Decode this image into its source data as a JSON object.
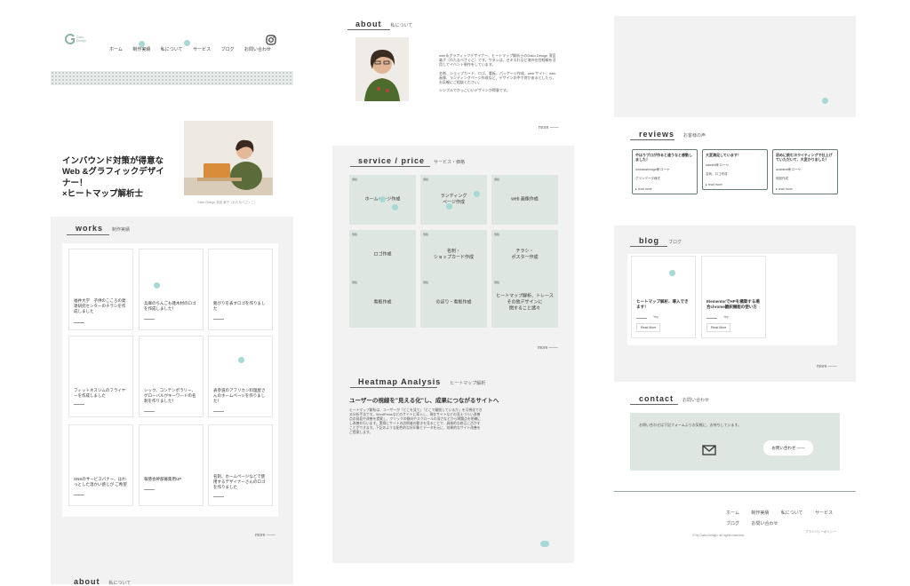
{
  "header": {
    "logo_text": "Gaku Design",
    "nav": [
      "ホーム",
      "制作実績",
      "私について",
      "サービス",
      "ブログ",
      "お問い合わせ"
    ],
    "instagram_icon": "instagram-icon"
  },
  "hero": {
    "headline": "インバウンド対策が得意な\nWeb &グラフィックデザイナー！\n×ヒートマップ解析士",
    "caption": "Gaku Design 英宮 楽子（わたなべさくこ）"
  },
  "works": {
    "title": "works",
    "subtitle": "制作実績",
    "items": [
      "福井大学　子供のこころの発達研究センターのチラシを作成しました",
      "兵庫のちんごも雑木材のロゴを作成しました！",
      "魁がりを表すロゴを作りました",
      "フィットネスジムのフライヤーを作成しました",
      "シック、コンテンポラリー、グローバルがキーワードの名刺を作りました！",
      "表参道のアフリカン料理屋さんのホームページを作りました！",
      "SNSのサービスバナー、ほわっとした温かい感じが ご希望",
      "報徳会幹部募集用UP",
      "名刺、ホームページなどで使用するデザイナーさんのロゴを作りました"
    ],
    "more": "more ——"
  },
  "about": {
    "title": "about",
    "subtitle": "私について",
    "paragraphs": [
      "web＆グラフィックデザイナー、ヒートマップ解析士のGaku Design 濱宮楽子（わたなべさくこ）です。ワタシは、セキスれなど海外在住経験を活用してイベント制作をしています。",
      "名刺、ショップカード、ロゴ、看板、パッケージ作成、web サイト、web 画像、ランディングページ作成など、デザインの中で何かあるとしたら、お気軽にご相談ください。",
      "シンプルでかっこいいデザインが得意です。"
    ],
    "more": "more ——",
    "bottom_title": "about",
    "bottom_subtitle": "私について"
  },
  "service": {
    "title": "service / price",
    "subtitle": "サービス・価格",
    "tag": "価格",
    "items": [
      "ホームページ作成",
      "ランディング\nページ作成",
      "web 画像作成",
      "ロゴ作成",
      "名刺・\nショップカード作成",
      "チラシ・\nポスター作成",
      "看板作成",
      "のぼり・看板作成",
      "ヒートマップ解析、トレース\nその他デザインに\n関すること諸々"
    ],
    "more": "more ——"
  },
  "heatmap": {
    "title": "Heatmap Analysis",
    "subtitle": "ヒートマップ解析",
    "headline": "ユーザーの視線を\"見える化\"し、成果につながるサイトへ",
    "body": "ヒートマップ解析は、ユーザーが「どこを見て」「どこで離脱しているか」を可視化できる分析手法です。WordPressなどのサイトに導入し、現在サイトなどの見えづらい改善点の発見や改善を提案し、クリックの傾向やスクロールの深さなどから問題点を明確にし改善を行います。実際にサイトの訪問者の動きを見ることで、具体的な修正に活かすことができます。下記のような配色的な好印象とデータを元に、効果的なサイト改善をご提案します。"
  },
  "reviews": {
    "title": "reviews",
    "subtitle": "お客様の声",
    "items": [
      {
        "title": "やはりプロが作ると違うなと感動しました！",
        "name": "motokashimige様 ローヤ",
        "meta": "グランデーダ様式",
        "more": "▸ read more"
      },
      {
        "title": "大変満足しています！",
        "name": "takeshi様 ローヤ",
        "meta": "名刺、ロゴ作成",
        "more": "▸ read more"
      },
      {
        "title": "初めに飲むヨライティングで仕上げていただいて、大変かりました！",
        "name": "azabtext様 ローヤ",
        "meta": "他設作成",
        "more": "▸ read more"
      }
    ]
  },
  "blog": {
    "title": "blog",
    "subtitle": "ブログ",
    "items": [
      {
        "title": "ヒートマップ解析、導入できます！",
        "date": "Yey",
        "button": "Read More"
      },
      {
        "title": "ElementorでHPを構築する場合chrome翻訳機能の使い方",
        "date": "Yey",
        "button": "Read More"
      }
    ],
    "more": "more ——"
  },
  "contact": {
    "title": "contact",
    "subtitle": "お問い合わせ",
    "text": "お問い合わせは下記フォームよりお気軽に、お待ちしています。",
    "button": "お問い合わせ ——",
    "mail_icon": "mail-icon"
  },
  "footer": {
    "nav_row1": [
      "ホーム",
      "制作実績",
      "私について",
      "サービス"
    ],
    "nav_row2": [
      "ブログ",
      "お問い合わせ"
    ],
    "copyright": "© by Gaku Design, all rights reserved.",
    "privacy": "プライバシーポリシー"
  },
  "colors": {
    "accent_mint": "#dde6e1",
    "dot": "#a8d8d4",
    "panel_gray": "#f2f2f2",
    "border_dark": "#6b7c74"
  }
}
